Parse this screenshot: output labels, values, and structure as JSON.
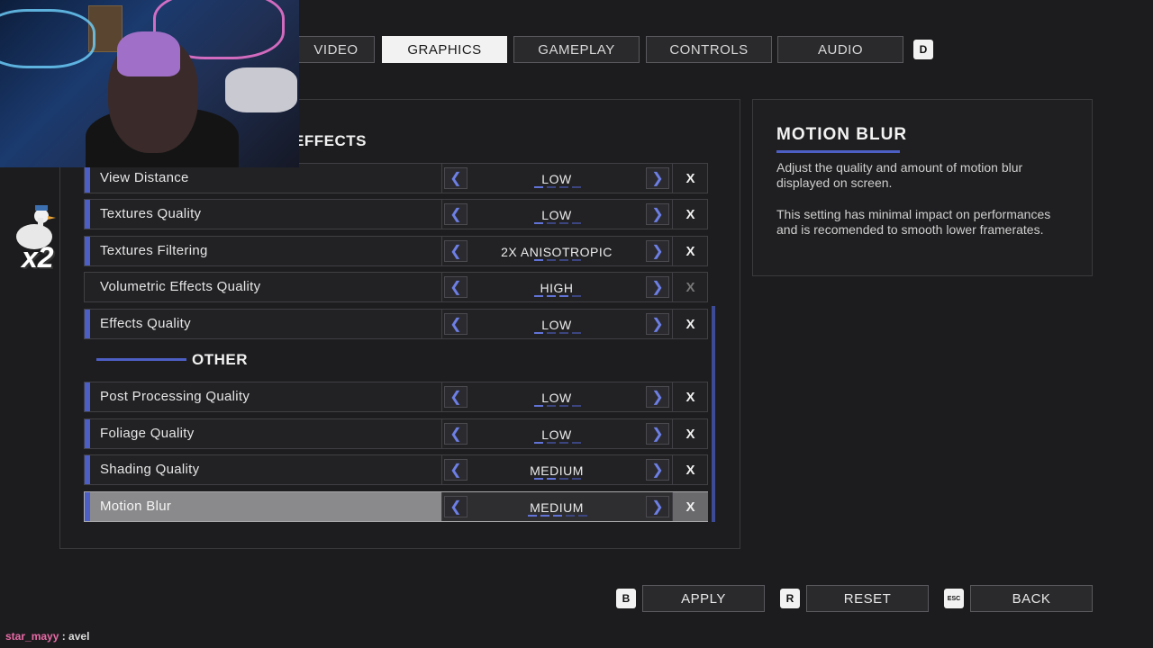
{
  "tabs": [
    {
      "label": "VIDEO",
      "active": false
    },
    {
      "label": "GRAPHICS",
      "active": true
    },
    {
      "label": "GAMEPLAY",
      "active": false
    },
    {
      "label": "CONTROLS",
      "active": false
    },
    {
      "label": "AUDIO",
      "active": false
    }
  ],
  "tab_key_right": "D",
  "sections": {
    "effects_title": "EFFECTS",
    "other_title": "OTHER"
  },
  "settings": [
    {
      "label": "View Distance",
      "value": "LOW",
      "level": 1,
      "reset": "X"
    },
    {
      "label": "Textures Quality",
      "value": "LOW",
      "level": 1,
      "reset": "X"
    },
    {
      "label": "Textures Filtering",
      "value": "2X ANISOTROPIC",
      "level": 1,
      "reset": "X"
    },
    {
      "label": "Volumetric Effects Quality",
      "value": "HIGH",
      "level": 3,
      "reset": "X"
    },
    {
      "label": "Effects Quality",
      "value": "LOW",
      "level": 1,
      "reset": "X"
    },
    {
      "label": "Post Processing Quality",
      "value": "LOW",
      "level": 1,
      "reset": "X"
    },
    {
      "label": "Foliage Quality",
      "value": "LOW",
      "level": 1,
      "reset": "X"
    },
    {
      "label": "Shading Quality",
      "value": "MEDIUM",
      "level": 2,
      "reset": "X"
    },
    {
      "label": "Motion Blur",
      "value": "MEDIUM",
      "level": 3,
      "reset": "X"
    }
  ],
  "info": {
    "title": "MOTION BLUR",
    "desc1": "Adjust the quality and amount of motion blur displayed on screen.",
    "desc2": "This setting has minimal impact on performances and is recomended to smooth lower framerates."
  },
  "footer": {
    "apply_key": "B",
    "apply_label": "APPLY",
    "reset_key": "R",
    "reset_label": "RESET",
    "back_key": "ESC",
    "back_label": "BACK"
  },
  "overlay": {
    "multiplier": "x2",
    "chat_user": "star_mayy",
    "chat_message": " : avel"
  },
  "colors": {
    "accent": "#4d5ec4",
    "background": "#1c1c1e"
  }
}
